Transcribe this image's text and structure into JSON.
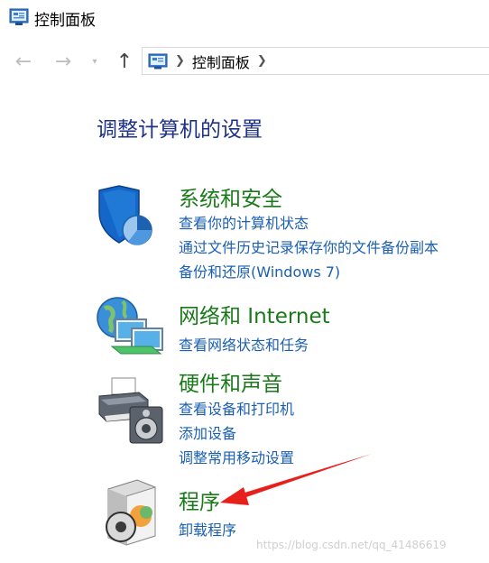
{
  "window": {
    "title": "控制面板"
  },
  "nav": {
    "breadcrumb": [
      "控制面板"
    ]
  },
  "page": {
    "heading": "调整计算机的设置"
  },
  "categories": [
    {
      "title": "系统和安全",
      "icon": "shield-icon",
      "links": [
        "查看你的计算机状态",
        "通过文件历史记录保存你的文件备份副本",
        "备份和还原(Windows 7)"
      ]
    },
    {
      "title": "网络和 Internet",
      "icon": "network-icon",
      "links": [
        "查看网络状态和任务"
      ]
    },
    {
      "title": "硬件和声音",
      "icon": "printer-speaker-icon",
      "links": [
        "查看设备和打印机",
        "添加设备",
        "调整常用移动设置"
      ]
    },
    {
      "title": "程序",
      "icon": "programs-icon",
      "links": [
        "卸载程序"
      ]
    }
  ],
  "watermark": "https://blog.csdn.net/qq_41486619",
  "colors": {
    "heading": "#1e3287",
    "category": "#1a7a1a",
    "link": "#1a5fb4",
    "annotation_arrow": "#e8201b"
  }
}
